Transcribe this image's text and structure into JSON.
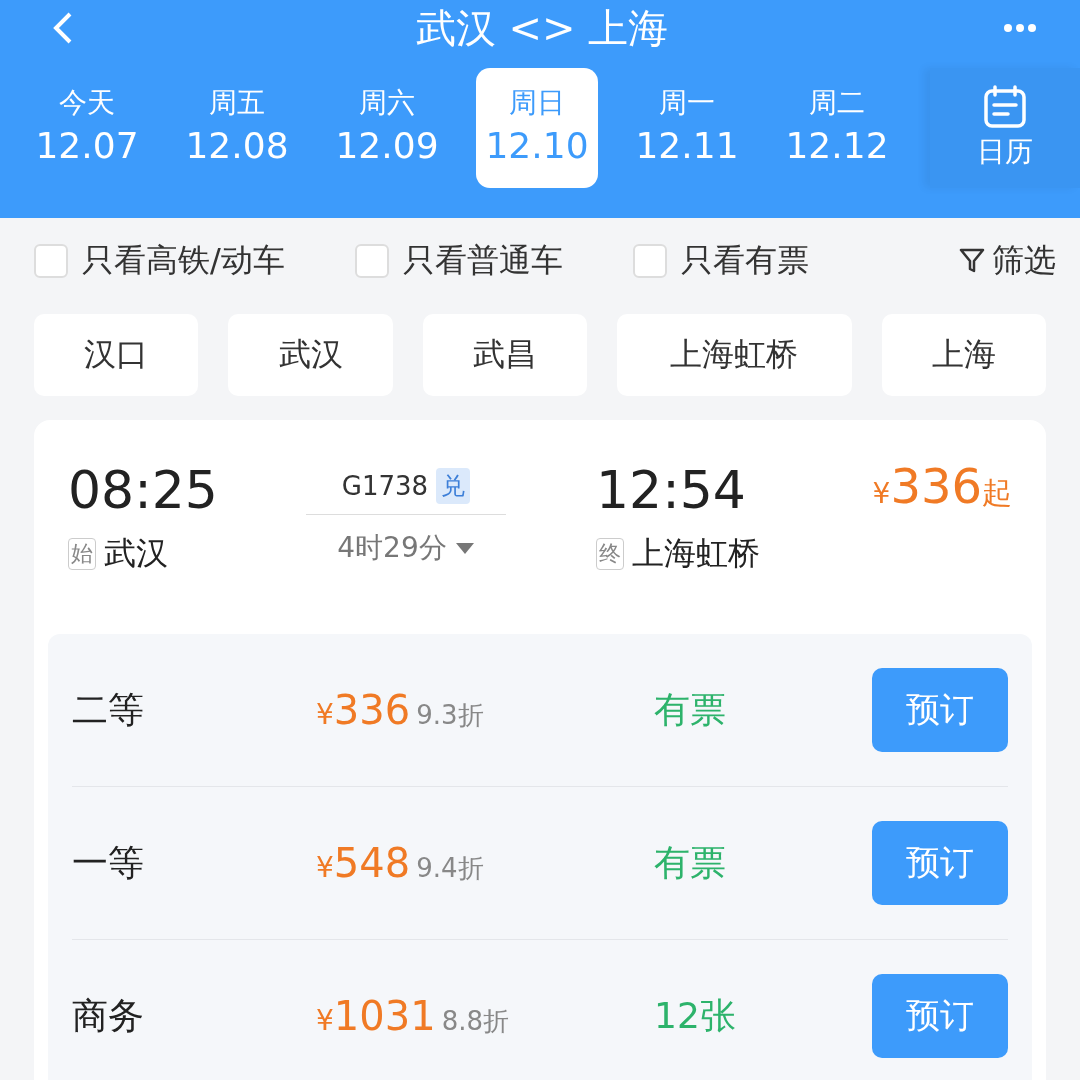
{
  "header": {
    "title": "武汉 <> 上海"
  },
  "dates": [
    {
      "weekday": "今天",
      "date": "12.07",
      "selected": false
    },
    {
      "weekday": "周五",
      "date": "12.08",
      "selected": false
    },
    {
      "weekday": "周六",
      "date": "12.09",
      "selected": false
    },
    {
      "weekday": "周日",
      "date": "12.10",
      "selected": true
    },
    {
      "weekday": "周一",
      "date": "12.11",
      "selected": false
    },
    {
      "weekday": "周二",
      "date": "12.12",
      "selected": false
    }
  ],
  "calendar_button": {
    "label": "日历"
  },
  "filters": [
    {
      "label": "只看高铁/动车",
      "checked": false
    },
    {
      "label": "只看普通车",
      "checked": false
    },
    {
      "label": "只看有票",
      "checked": false
    }
  ],
  "filter_button": {
    "label": "筛选"
  },
  "stations": [
    "汉口",
    "武汉",
    "武昌",
    "上海虹桥",
    "上海"
  ],
  "train": {
    "depart_time": "08:25",
    "depart_tag": "始",
    "depart_station": "武汉",
    "number": "G1738",
    "number_tag": "兑",
    "duration": "4时29分",
    "arrive_time": "12:54",
    "arrive_tag": "终",
    "arrive_station": "上海虹桥",
    "price_currency": "¥",
    "price": "336",
    "price_suffix": "起",
    "seats": [
      {
        "class": "二等",
        "currency": "¥",
        "price": "336",
        "discount": "9.3折",
        "availability": "有票",
        "button": "预订"
      },
      {
        "class": "一等",
        "currency": "¥",
        "price": "548",
        "discount": "9.4折",
        "availability": "有票",
        "button": "预订"
      },
      {
        "class": "商务",
        "currency": "¥",
        "price": "1031",
        "discount": "8.8折",
        "availability": "12张",
        "button": "预订"
      }
    ]
  }
}
